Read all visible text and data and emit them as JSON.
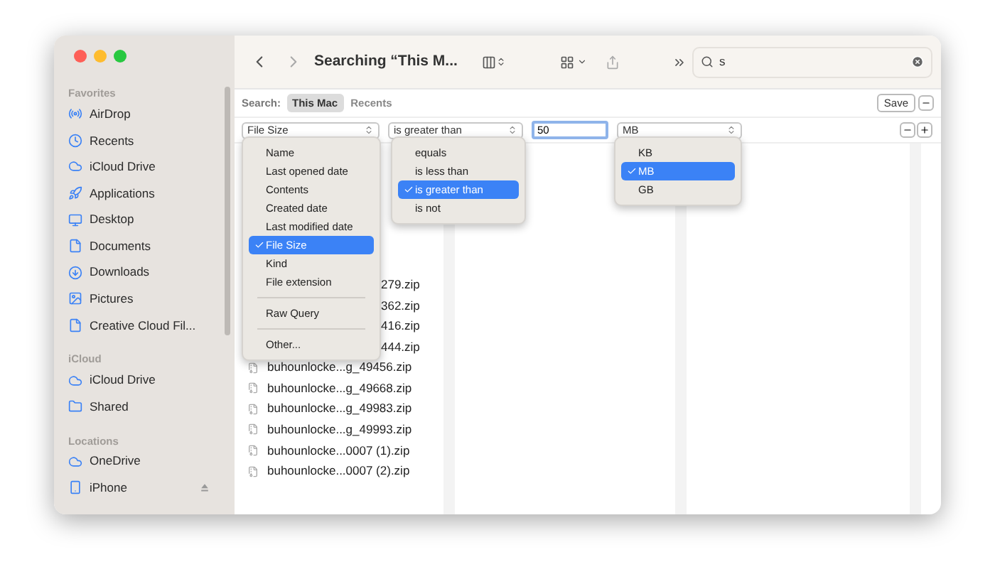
{
  "toolbar": {
    "title": "Searching “This M...",
    "search": {
      "value": "s"
    }
  },
  "search_scope": {
    "label": "Search:",
    "options": [
      {
        "label": "This Mac",
        "selected": true
      },
      {
        "label": "Recents",
        "selected": false
      }
    ],
    "save": "Save"
  },
  "criteria": {
    "attribute": "File Size",
    "operator": "is greater than",
    "value": "50",
    "unit": "MB"
  },
  "sidebar": [
    {
      "heading": "Favorites",
      "items": [
        "AirDrop",
        "Recents",
        "iCloud Drive",
        "Applications",
        "Desktop",
        "Documents",
        "Downloads",
        "Pictures",
        "Creative Cloud Fil..."
      ]
    },
    {
      "heading": "iCloud",
      "items": [
        "iCloud Drive",
        "Shared"
      ]
    },
    {
      "heading": "Locations",
      "items": [
        "OneDrive",
        "iPhone"
      ]
    }
  ],
  "files": [
    {
      "name": "279.zip",
      "kind": "partial"
    },
    {
      "name": "362.zip",
      "kind": "partial"
    },
    {
      "name": "416.zip",
      "kind": "partial"
    },
    {
      "name": "444.zip",
      "kind": "partial"
    },
    {
      "name": "buhounlocke...g_49456.zip",
      "kind": "full"
    },
    {
      "name": "buhounlocke...g_49668.zip",
      "kind": "full"
    },
    {
      "name": "buhounlocke...g_49983.zip",
      "kind": "full"
    },
    {
      "name": "buhounlocke...g_49993.zip",
      "kind": "full"
    },
    {
      "name": "buhounlocke...0007 (1).zip",
      "kind": "full"
    },
    {
      "name": "buhounlocke...0007 (2).zip",
      "kind": "full"
    }
  ],
  "menus": [
    {
      "items": [
        {
          "label": "Name",
          "selected": false
        },
        {
          "label": "Last opened date",
          "selected": false
        },
        {
          "label": "Contents",
          "selected": false
        },
        {
          "label": "Created date",
          "selected": false
        },
        {
          "label": "Last modified date",
          "selected": false
        },
        {
          "label": "File Size",
          "selected": true
        },
        {
          "label": "Kind",
          "selected": false
        },
        {
          "label": "File extension",
          "selected": false
        },
        {
          "kind": "separator"
        },
        {
          "label": "Raw Query",
          "selected": false
        },
        {
          "kind": "separator"
        },
        {
          "label": "Other...",
          "selected": false
        }
      ]
    },
    {
      "items": [
        {
          "label": "equals",
          "selected": false
        },
        {
          "label": "is less than",
          "selected": false
        },
        {
          "label": "is greater than",
          "selected": true
        },
        {
          "label": "is not",
          "selected": false
        }
      ]
    },
    {
      "items": [
        {
          "label": "KB",
          "selected": false
        },
        {
          "label": "MB",
          "selected": true
        },
        {
          "label": "GB",
          "selected": false
        }
      ]
    }
  ]
}
